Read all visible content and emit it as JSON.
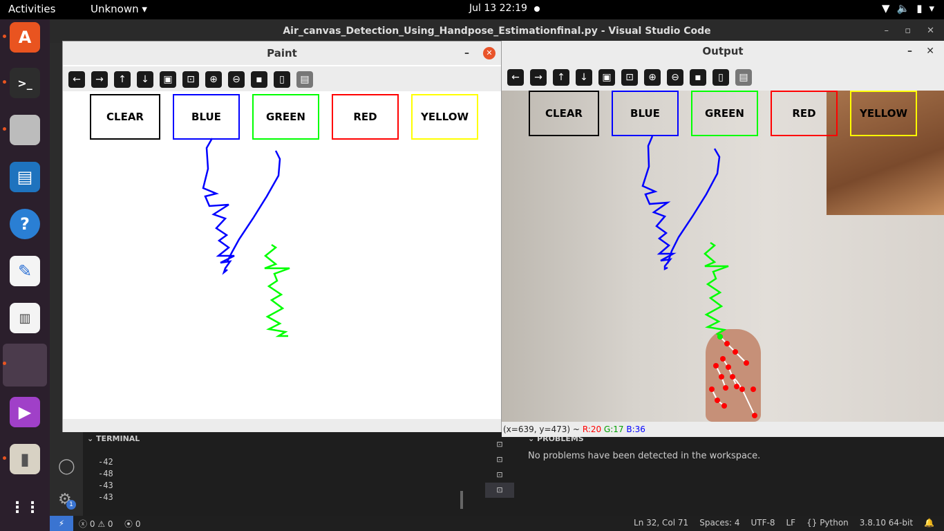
{
  "topbar": {
    "activities": "Activities",
    "app_menu": "Unknown ▾",
    "clock": "Jul 13  22:19",
    "wifi_icon": "wifi-icon",
    "volume_icon": "volume-icon",
    "battery_icon": "battery-icon"
  },
  "vscode": {
    "title": "Air_canvas_Detection_Using_Handpose_Estimationfinal.py - Visual Studio Code",
    "terminal_header": "TERMINAL",
    "terminal_lines": [
      "-42",
      "-48",
      "-43",
      "-43"
    ],
    "problems_header": "PROBLEMS",
    "problems_message": "No problems have been detected in the workspace.",
    "settings_badge": "1",
    "status": {
      "errors": "0",
      "warnings": "0",
      "ports": "0",
      "position": "Ln 32, Col 71",
      "spaces": "Spaces: 4",
      "encoding": "UTF-8",
      "eol": "LF",
      "language": "Python",
      "interpreter": "3.8.10 64-bit"
    }
  },
  "paint": {
    "title": "Paint",
    "buttons": [
      "CLEAR",
      "BLUE",
      "GREEN",
      "RED",
      "YELLOW"
    ]
  },
  "output": {
    "title": "Output",
    "buttons": [
      "CLEAR",
      "BLUE",
      "GREEN",
      "RED",
      "YELLOW"
    ],
    "status_coords": "(x=639, y=473) ~",
    "status_r": "R:20",
    "status_g": "G:17",
    "status_b": "B:36"
  },
  "colors": {
    "clear": "#000000",
    "blue": "#0000ff",
    "green": "#00ff00",
    "red": "#ff0000",
    "yellow": "#ffff00",
    "ubuntu_orange": "#e95420"
  }
}
